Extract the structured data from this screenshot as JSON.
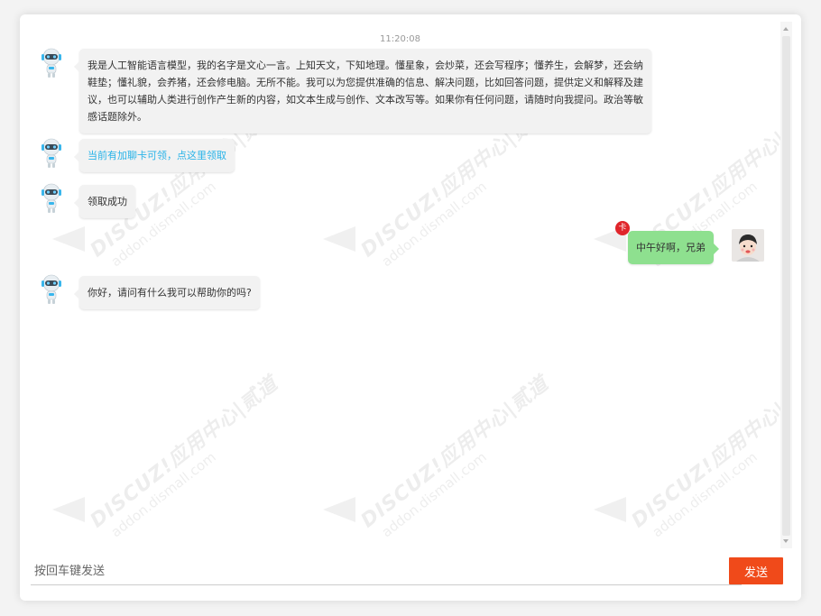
{
  "chat": {
    "timestamp": "11:20:08",
    "messages": [
      {
        "sender": "bot",
        "text": "我是人工智能语言模型，我的名字是文心一言。上知天文，下知地理。懂星象，会炒菜，还会写程序；懂养生，会解梦，还会纳鞋垫；懂礼貌，会养猪，还会修电脑。无所不能。我可以为您提供准确的信息、解决问题，比如回答问题，提供定义和解释及建议，也可以辅助人类进行创作产生新的内容，如文本生成与创作、文本改写等。如果你有任何问题，请随时向我提问。政治等敏感话题除外。"
      },
      {
        "sender": "bot",
        "text": "当前有加聊卡可领，点这里领取",
        "is_link": true
      },
      {
        "sender": "bot",
        "text": "领取成功"
      },
      {
        "sender": "user",
        "text": "中午好啊，兄弟",
        "badge": "卡"
      },
      {
        "sender": "bot",
        "text": "你好，请问有什么我可以帮助你的吗?"
      }
    ]
  },
  "watermark": {
    "line1": "DISCUZ!应用中心|贰道",
    "line2": "addon.dismall.com"
  },
  "composer": {
    "placeholder": "按回车键发送",
    "send_label": "发送"
  },
  "colors": {
    "send_button": "#f04a1a",
    "user_bubble": "#8ee08f",
    "bot_bubble": "#f2f2f2",
    "link": "#29b3e8",
    "badge": "#e0252b"
  },
  "icons": {
    "bot_avatar": "robot-avatar-icon",
    "user_avatar": "user-avatar-icon"
  }
}
